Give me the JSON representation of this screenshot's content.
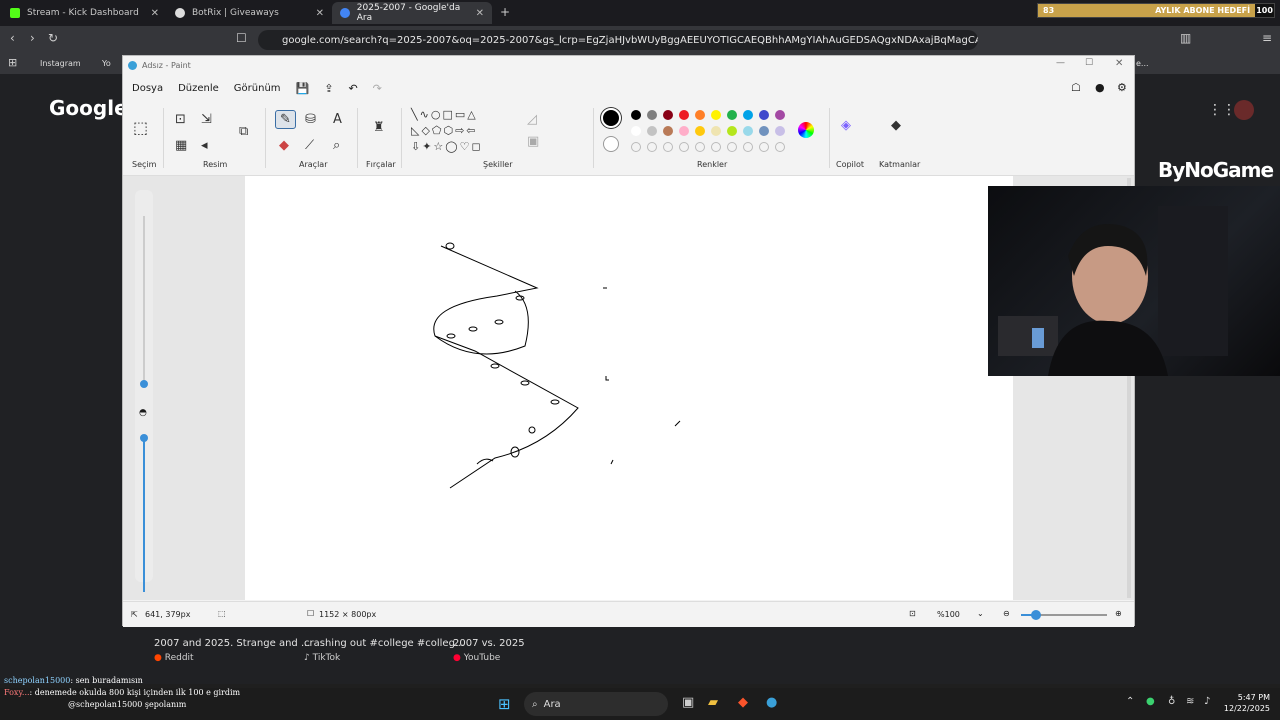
{
  "tabs": [
    {
      "label": "Stream - Kick Dashboard",
      "color": "#53fc18"
    },
    {
      "label": "BotRix | Giveaways",
      "color": "#dddddd"
    },
    {
      "label": "2025-2007 - Google'da Ara",
      "color": "#4285f4"
    }
  ],
  "goal": {
    "current": "83",
    "label": "AYLIK ABONE HEDEFİ",
    "target": "100"
  },
  "url": "google.com/search?q=2025-2007&oq=2025-2007&gs_lcrp=EgZjaHJvbWUyBggAEEUYOTIGCAEQBhhAMgYIAhAuGEDSAQgxNDAxajBqMagCALACAA...",
  "bookmarks": [
    {
      "label": "Instagram"
    },
    {
      "label": "Yo"
    },
    {
      "label": "e..."
    }
  ],
  "google_logo": "Google",
  "paint": {
    "title": "Adsız - Paint",
    "menu": [
      "Dosya",
      "Düzenle",
      "Görünüm"
    ],
    "groups": [
      "Seçim",
      "Resim",
      "Araçlar",
      "Fırçalar",
      "Şekiller",
      "Renkler",
      "Copilot",
      "Katmanlar"
    ],
    "status": {
      "cursor": "641, 379px",
      "size": "1152 × 800px",
      "zoom": "%100"
    },
    "palette_row1": [
      "#000000",
      "#7f7f7f",
      "#880015",
      "#ed1c24",
      "#ff7f27",
      "#fff200",
      "#22b14c",
      "#00a2e8",
      "#3f48cc",
      "#a349a4"
    ],
    "palette_row2": [
      "#ffffff",
      "#c3c3c3",
      "#b97a57",
      "#ffaec9",
      "#ffc90e",
      "#efe4b0",
      "#b5e61d",
      "#99d9ea",
      "#7092be",
      "#c8bfe7"
    ]
  },
  "brand": "ByNoGame",
  "results": [
    {
      "title": "2007 and 2025. Strange and ...",
      "source": "Reddit"
    },
    {
      "title": "crashing out #college #colleg...",
      "source": "TikTok"
    },
    {
      "title": "2007 vs. 2025",
      "source": "YouTube"
    }
  ],
  "chat": [
    {
      "user": "schepolan15000",
      "msg": ": sen buradamısın"
    },
    {
      "user": "Foxy...",
      "msg": ": denemede okulda 800 kişi içinden ilk 100 e girdim"
    },
    {
      "user": "",
      "msg": "@schepolan15000 şepolanım"
    }
  ],
  "taskbar": {
    "search": "Ara",
    "time": "5:47 PM",
    "date": "12/22/2025"
  }
}
